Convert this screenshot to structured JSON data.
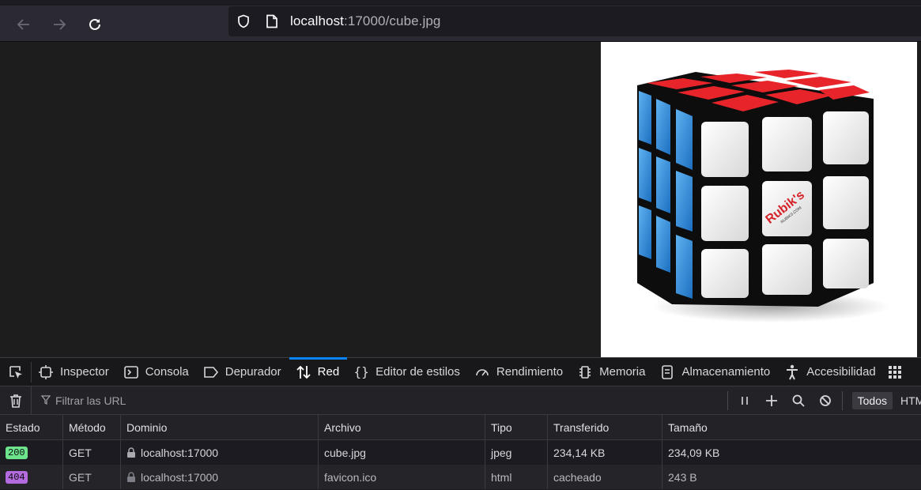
{
  "browser": {
    "url_host": "localhost",
    "url_rest": ":17000/cube.jpg"
  },
  "image": {
    "logo_text": "Rubik's",
    "logo_subtext": "RUBIKS.COM"
  },
  "devtools": {
    "tabs": [
      {
        "label": "Inspector",
        "icon": "inspector-icon"
      },
      {
        "label": "Consola",
        "icon": "console-icon"
      },
      {
        "label": "Depurador",
        "icon": "debugger-icon"
      },
      {
        "label": "Red",
        "icon": "network-icon",
        "selected": true
      },
      {
        "label": "Editor de estilos",
        "icon": "style-editor-icon"
      },
      {
        "label": "Rendimiento",
        "icon": "performance-icon"
      },
      {
        "label": "Memoria",
        "icon": "memory-icon"
      },
      {
        "label": "Almacenamiento",
        "icon": "storage-icon"
      },
      {
        "label": "Accesibilidad",
        "icon": "accessibility-icon"
      }
    ],
    "accent": "#0a84ff"
  },
  "net_toolbar": {
    "filter_placeholder": "Filtrar las URL",
    "filter_all": "Todos",
    "filter_html": "HTML"
  },
  "table": {
    "headers": {
      "estado": "Estado",
      "metodo": "Método",
      "dominio": "Dominio",
      "archivo": "Archivo",
      "tipo": "Tipo",
      "transferido": "Transferido",
      "tamano": "Tamaño"
    },
    "rows": [
      {
        "status": "200",
        "status_color": "#6ce38c",
        "method": "GET",
        "domain": "localhost:17000",
        "file": "cube.jpg",
        "type": "jpeg",
        "transferred": "234,14 KB",
        "size": "234,09 KB"
      },
      {
        "status": "404",
        "status_color": "#b36bdf",
        "method": "GET",
        "domain": "localhost:17000",
        "file": "favicon.ico",
        "type": "html",
        "transferred": "cacheado",
        "size": "243 B"
      }
    ]
  }
}
